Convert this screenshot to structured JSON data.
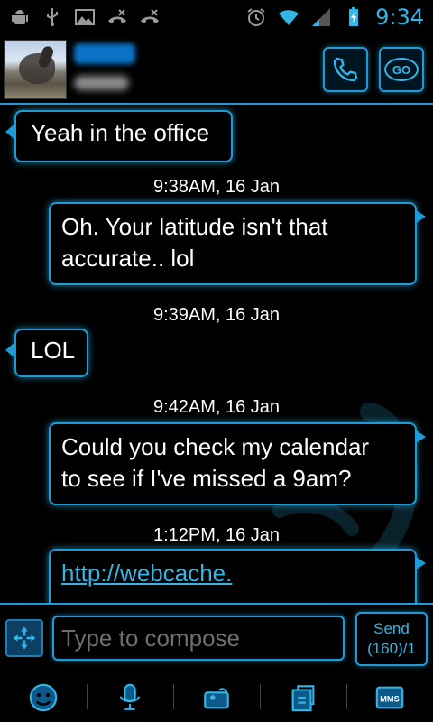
{
  "status_bar": {
    "time": "9:34",
    "icons": [
      "android-debug-icon",
      "usb-icon",
      "picture-icon",
      "missed-call-icon",
      "missed-call-icon",
      "alarm-icon",
      "wifi-icon",
      "signal-icon",
      "battery-charging-icon"
    ]
  },
  "header": {
    "contact_name": "M... ...",
    "contact_number": "••••••••••",
    "call_icon": "phone-icon",
    "go_label": "GO"
  },
  "messages": [
    {
      "direction": "incoming",
      "text": "Yeah in the office"
    },
    {
      "timestamp": "9:38AM, 16 Jan"
    },
    {
      "direction": "outgoing",
      "line1": "Oh. Your latitude isn't that",
      "line2": "accurate.. lol"
    },
    {
      "timestamp": "9:39AM, 16 Jan"
    },
    {
      "direction": "incoming",
      "text": "LOL"
    },
    {
      "timestamp": "9:42AM, 16 Jan"
    },
    {
      "direction": "outgoing",
      "line1": "Could you check my calendar",
      "line2": "to see if I've missed a 9am?"
    },
    {
      "timestamp": "1:12PM, 16 Jan"
    },
    {
      "direction": "outgoing",
      "link": "http://webcache."
    }
  ],
  "compose": {
    "placeholder": "Type to compose",
    "send_label": "Send",
    "counter": "(160)/1"
  },
  "toolbar": {
    "items": [
      "smiley-icon",
      "microphone-icon",
      "attach-contact-icon",
      "attach-file-icon",
      "mms-icon"
    ],
    "mms_label": "MMS"
  },
  "colors": {
    "accent": "#33b5e5",
    "border": "#1e9ad6",
    "background": "#000000"
  }
}
